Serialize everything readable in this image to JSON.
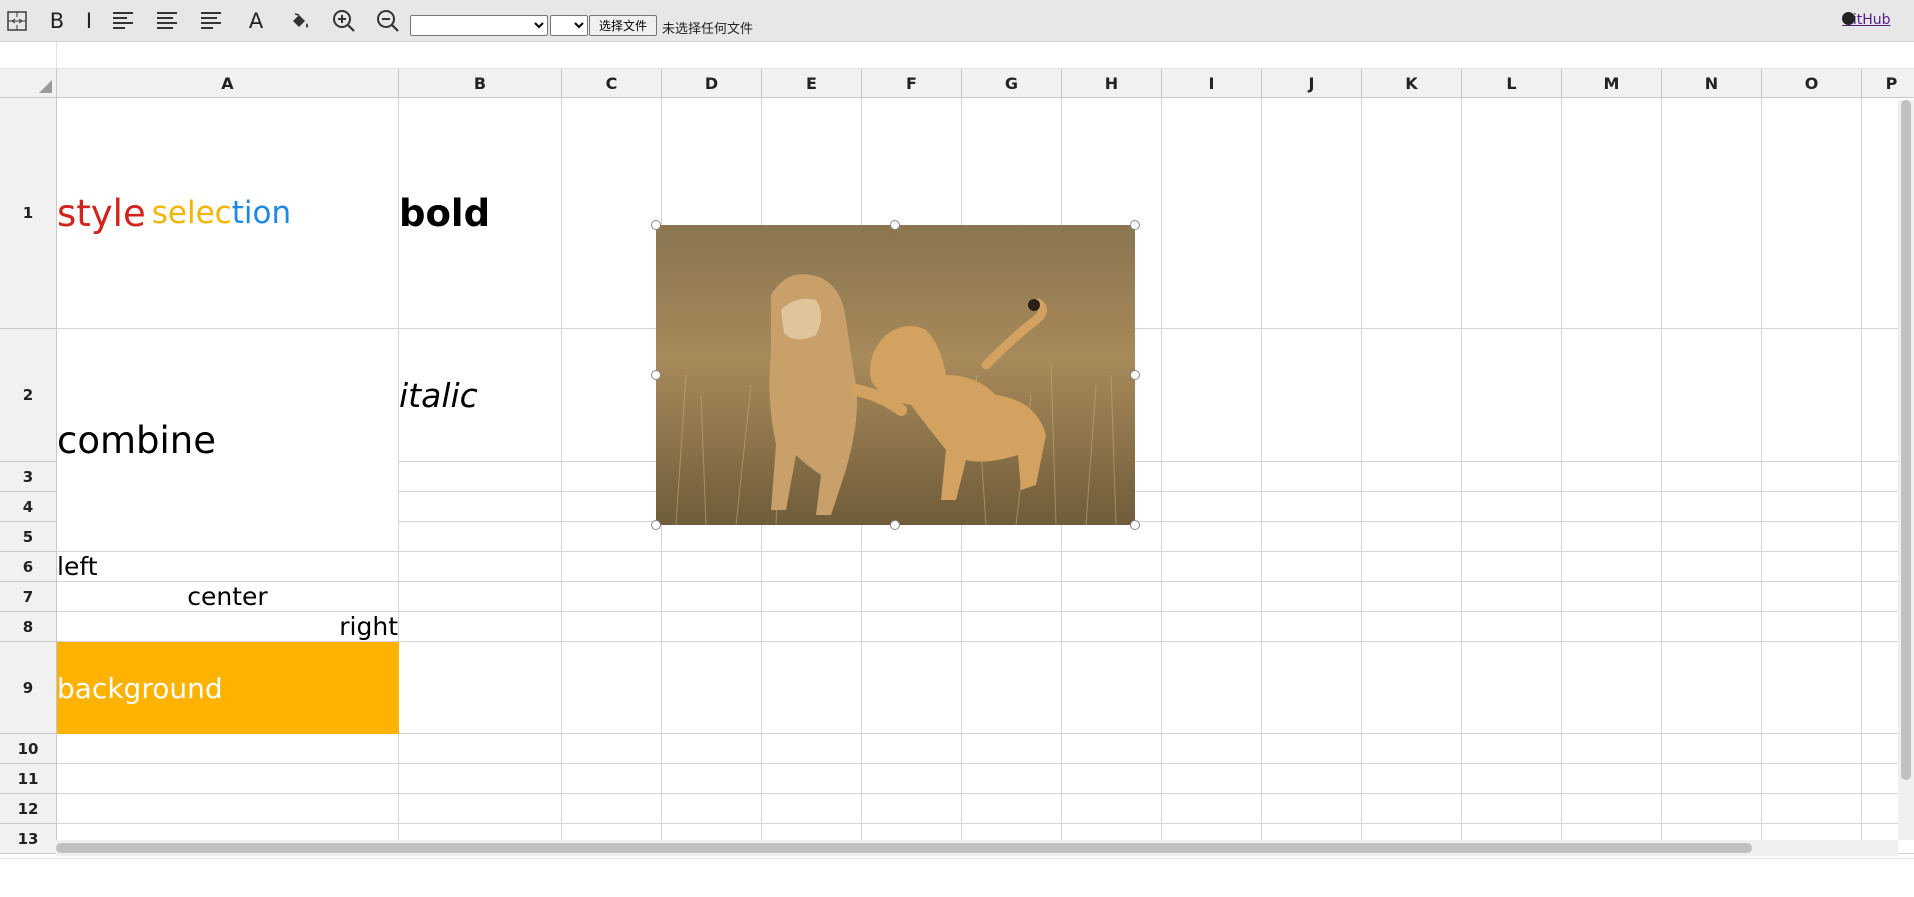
{
  "toolbar": {
    "tools": [
      {
        "name": "merge-cells",
        "icon": "merge-cells-icon"
      },
      {
        "name": "bold",
        "label": "B",
        "icon": "bold-icon"
      },
      {
        "name": "italic",
        "label": "I",
        "icon": "italic-icon"
      },
      {
        "name": "align-left",
        "icon": "align-left-icon"
      },
      {
        "name": "align-center",
        "icon": "align-center-icon"
      },
      {
        "name": "align-right",
        "icon": "align-right-icon"
      },
      {
        "name": "font-color",
        "label": "A",
        "icon": "font-color-icon"
      },
      {
        "name": "fill-color",
        "icon": "paint-bucket-icon"
      },
      {
        "name": "zoom-in",
        "icon": "zoom-in-icon"
      },
      {
        "name": "zoom-out",
        "icon": "zoom-out-icon"
      }
    ],
    "font_family_value": "",
    "font_size_value": "",
    "file_button_label": "选择文件",
    "file_status": "未选择任何文件",
    "github_label": "GitHub"
  },
  "columns": [
    "A",
    "B",
    "C",
    "D",
    "E",
    "F",
    "G",
    "H",
    "I",
    "J",
    "K",
    "L",
    "M",
    "N",
    "O",
    "P"
  ],
  "rows": [
    "1",
    "2",
    "3",
    "4",
    "5",
    "6",
    "7",
    "8",
    "9",
    "10",
    "11",
    "12",
    "13"
  ],
  "cells": {
    "A1": {
      "parts": [
        {
          "text": "style",
          "color": "#d0241c"
        },
        {
          "text": "sele",
          "color": "#f2b600"
        },
        {
          "text": "c",
          "color": "#f2b600"
        },
        {
          "text": "t",
          "color": "#1e88e5"
        },
        {
          "text": "i",
          "color": "#1e88e5"
        },
        {
          "text": "on",
          "color": "#1e88e5"
        }
      ]
    },
    "B1": {
      "text": "bold",
      "bold": true
    },
    "B2": {
      "text": "italic",
      "italic": true
    },
    "A2": {
      "text": "combine",
      "merged": "A2:A5"
    },
    "A6": {
      "text": "left",
      "align": "left"
    },
    "A7": {
      "text": "center",
      "align": "center"
    },
    "A8": {
      "text": "right",
      "align": "right"
    },
    "A9": {
      "text": "background",
      "background": "#ffb300",
      "color": "#ffffff"
    }
  },
  "picture": {
    "description_icon": "lion-cub-photo",
    "anchor": "D1:H5"
  },
  "colors": {
    "header_bg": "#f1f1f1",
    "grid_line": "#d4d4d4",
    "toolbar_bg": "#e7e7e7"
  }
}
